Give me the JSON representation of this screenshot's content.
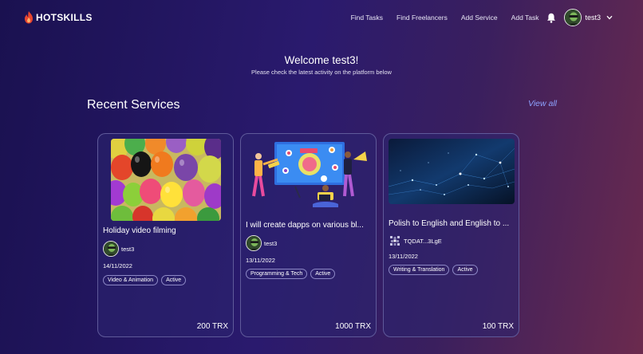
{
  "brand": {
    "name": "HOTSKILLS",
    "accent": "#e8462f"
  },
  "nav": {
    "links": [
      "Find Tasks",
      "Find Freelancers",
      "Add Service",
      "Add Task"
    ],
    "username": "test3"
  },
  "welcome": {
    "title": "Welcome test3!",
    "subtitle": "Please check the latest activity on the platform below"
  },
  "section": {
    "title": "Recent Services",
    "view_all": "View all"
  },
  "services": [
    {
      "title": "Holiday video filming",
      "seller": "test3",
      "date": "14/11/2022",
      "tags": [
        "Video & Animation",
        "Active"
      ],
      "price": "200 TRX"
    },
    {
      "title": "I will create dapps on various bl...",
      "seller": "test3",
      "date": "13/11/2022",
      "tags": [
        "Programming & Tech",
        "Active"
      ],
      "price": "1000 TRX"
    },
    {
      "title": "Polish to English and English to ...",
      "seller": "TQDAT...3LgE",
      "date": "13/11/2022",
      "tags": [
        "Writing & Translation",
        "Active"
      ],
      "price": "100 TRX"
    }
  ],
  "colors": {
    "view_all": "#8ea3ff",
    "card_border": "#5f5a9a"
  }
}
